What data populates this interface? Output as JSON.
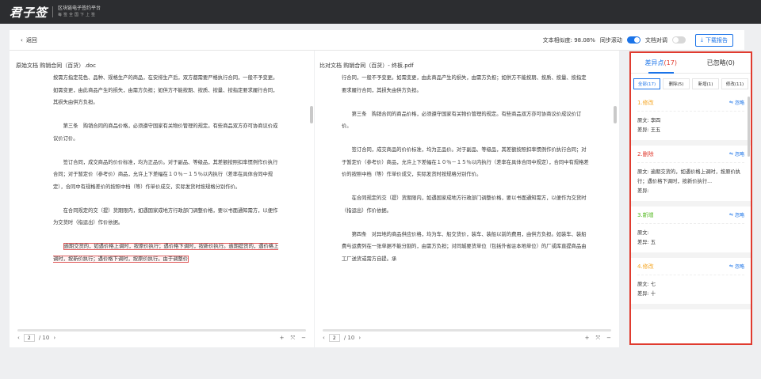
{
  "app": {
    "logo": "君子签",
    "slogan_line1": "区块链电子签约平台",
    "slogan_line2": "每签全国下上签"
  },
  "toolbar": {
    "back_label": "返回",
    "similarity_label": "文本相似度: 98.08%",
    "sync_scroll_label": "同步滚动",
    "sync_scroll_on": true,
    "text_align_label": "文档对调",
    "text_align_on": false,
    "download_label": "下载报告"
  },
  "left_doc": {
    "title": "原始文档   购销合同（百货）.doc",
    "paragraphs": [
      "按需方指定花色、品种、规格生产的商品，在安排生产后，双方都需要严格执行合同，一般不予变更。如需变更，由此商品产生的损失，由需方负担；如供方不能按期、按质、按量、按指定要求履行合同，其损失由供方负担。",
      "第三条　购销合同的商品价格，必须遵守国家有关物价管理的规定。有些商品双方亦可协商议价成议价订价。",
      "签订合同，成交商品的价价标准，均为正品价。对于副品、等级品，其差额按照扣率惯例作价执行合同；对于暂定价（参考价）商品，允许上下差幅在１０％－１５％以内执行（差率在具体合同中规定），合同中有规格差价的按照中档（等）作单价成交，实际发货时按规格分别作价。",
      "在合同规定的交（提）货期限内，如遇国家成地方行政部门调整价格，要以书面通知需方，以便作为交货时（指运出）作价依据。"
    ],
    "highlight": "逾期交货的，如遇价格上调时，按原价执行；遇价格下调时，按新价执行。逾期提货的，遇价格上调时，按新价执行；遇价格下调时，按原价执行。由于调整价",
    "page_current": "2",
    "page_total": "/ 10"
  },
  "right_doc": {
    "title": "比对文档   购销合同（百货）- 终板.pdf",
    "paragraphs": [
      "行合同，一般不予变更。如需变更，由此商品产生的损失，由需方负担；如供方不能按期、按质、按量、按指定要求履行合同，其损失由供方负担。",
      "第三条　购销合同的商品价格，必须遵守国家有关物价管理的规定。有些商品双方亦可协商议价成议价订价。",
      "签订合同，成交商品的价价标准，均为正品价。对于副品、等级品，其差额按照扣率惯例作价执行合同；对于暂定价（参考价）商品，允许上下差幅在１０％－１５％以内执行（差率在具体合同中规定），合同中有规格差价的按照中档（等）作单价成交，实际发货时按规格分别作价。",
      "在合同规定的交（提）货期限内，如遇国家成地方行政部门调整价格，要以书面通知需方，以便作为交货时（指运出）作价依据。",
      "第四条　对异地的商品供应价格，均为车、船交货价，装车、装船以前的费用，由供方负担。如装车、装船费与运费列在一张单据不能分割的，由需方负担；对同城要货单位（包括外省驻本地单位）的厂或库直提商品由工厂送货或需方自提。承"
    ],
    "page_current": "2",
    "page_total": "/ 10"
  },
  "diff_panel": {
    "tab_diff_label": "差异点",
    "tab_diff_count": "(17)",
    "tab_ignored_label": "已忽略(0)",
    "filters": [
      "全部(17)",
      "删除(5)",
      "新增(1)",
      "修改(11)"
    ],
    "ignore_label": "忽略",
    "items": [
      {
        "title": "1.修改",
        "type": "mod",
        "orig_label": "原文:",
        "orig": "李四",
        "diff_label": "差异:",
        "diff": "王五"
      },
      {
        "title": "2.删除",
        "type": "del",
        "orig_label": "原文:",
        "orig": "逾期交货的，如遇价格上调时，按原价执行；遇价格下调时，按新价执行...",
        "diff_label": "差异:",
        "diff": ""
      },
      {
        "title": "3.新增",
        "type": "add",
        "orig_label": "原文:",
        "orig": "",
        "diff_label": "差异:",
        "diff": "五"
      },
      {
        "title": "4.修改",
        "type": "mod",
        "orig_label": "原文:",
        "orig": "七",
        "diff_label": "差异:",
        "diff": "十"
      }
    ]
  },
  "colors": {
    "accent": "#1a73e8",
    "alert": "#e03b2f",
    "modify": "#f5a623",
    "add": "#52b81f"
  }
}
